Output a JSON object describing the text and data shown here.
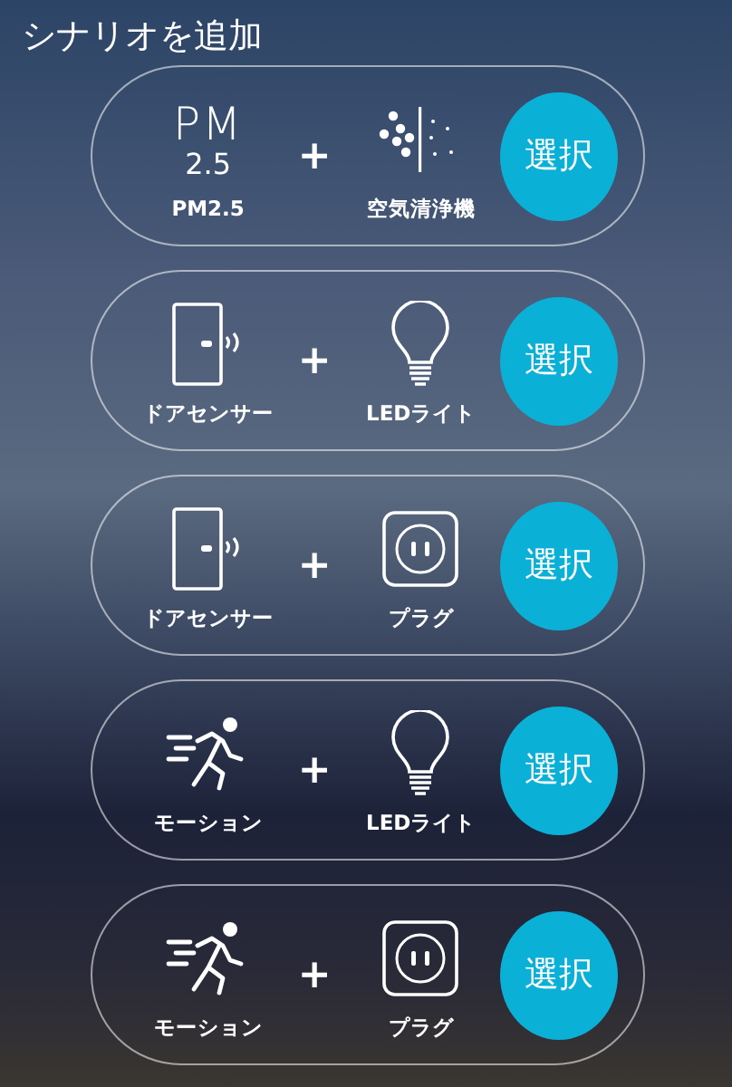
{
  "title": "シナリオを追加",
  "scenarios": [
    {
      "trigger": {
        "kind": "pm25",
        "icon_lines": [
          "PM",
          "2.5"
        ],
        "label": "PM2.5"
      },
      "plus": "+",
      "action": {
        "kind": "purifier",
        "label": "空気清浄機"
      },
      "button": "選択"
    },
    {
      "trigger": {
        "kind": "door",
        "label": "ドアセンサー"
      },
      "plus": "+",
      "action": {
        "kind": "bulb",
        "label": "LEDライト"
      },
      "button": "選択"
    },
    {
      "trigger": {
        "kind": "door",
        "label": "ドアセンサー"
      },
      "plus": "+",
      "action": {
        "kind": "plug",
        "label": "プラグ"
      },
      "button": "選択"
    },
    {
      "trigger": {
        "kind": "motion",
        "label": "モーション"
      },
      "plus": "+",
      "action": {
        "kind": "bulb",
        "label": "LEDライト"
      },
      "button": "選択"
    },
    {
      "trigger": {
        "kind": "motion",
        "label": "モーション"
      },
      "plus": "+",
      "action": {
        "kind": "plug",
        "label": "プラグ"
      },
      "button": "選択"
    }
  ]
}
